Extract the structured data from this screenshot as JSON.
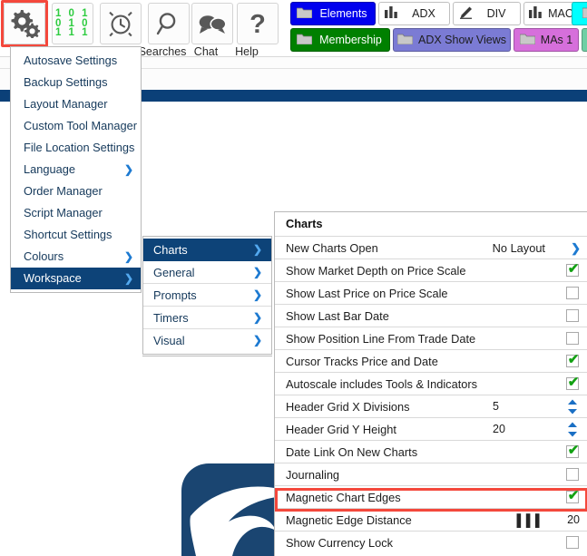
{
  "toolbar": {
    "buttons": [
      {
        "name": "settings",
        "icon": "gears-icon",
        "label": "",
        "highlighted": true
      },
      {
        "name": "binary",
        "icon": "binary-icon",
        "label": "",
        "rows": [
          "1 0 1",
          "0 1 0",
          "1 1 1"
        ]
      },
      {
        "name": "alarm",
        "icon": "alarm-clock-icon",
        "label": ""
      },
      {
        "name": "searches",
        "icon": "magnifier-icon",
        "label": "Searches"
      },
      {
        "name": "chat",
        "icon": "speech-bubbles-icon",
        "label": "Chat"
      },
      {
        "name": "help",
        "icon": "question-mark-icon",
        "label": "Help"
      }
    ],
    "chart_tabs_row1": [
      {
        "label": "Elements",
        "icon": "folder-icon",
        "bg": "#0000ee",
        "fg": "#ffffff"
      },
      {
        "label": "ADX",
        "icon": "bar-chart-icon",
        "bg": "#ffffff",
        "fg": "#1d1d1d"
      },
      {
        "label": "DIV",
        "icon": "pen-icon",
        "bg": "#ffffff",
        "fg": "#1d1d1d"
      },
      {
        "label": "MACDC",
        "icon": "bar-chart-icon",
        "bg": "#ffffff",
        "fg": "#1d1d1d"
      },
      {
        "label": "",
        "icon": "folder-icon",
        "bg": "#00ffff",
        "fg": "#1d1d1d"
      }
    ],
    "chart_tabs_row2": [
      {
        "label": "Membership",
        "icon": "folder-icon",
        "bg": "#008000",
        "fg": "#ffffff"
      },
      {
        "label": "ADX Show Views",
        "icon": "folder-icon",
        "bg": "#7b7bd4",
        "fg": "#1d1d1d"
      },
      {
        "label": "MAs 1",
        "icon": "folder-icon",
        "bg": "#d66fdb",
        "fg": "#1d1d1d"
      },
      {
        "label": "",
        "icon": "folder-icon",
        "bg": "#6fcfa4",
        "fg": "#1d1d1d"
      }
    ]
  },
  "menu": {
    "items": [
      {
        "label": "Autosave Settings",
        "submenu": false,
        "selected": false
      },
      {
        "label": "Backup Settings",
        "submenu": false,
        "selected": false
      },
      {
        "label": "Layout Manager",
        "submenu": false,
        "selected": false
      },
      {
        "label": "Custom Tool Manager",
        "submenu": false,
        "selected": false
      },
      {
        "label": "File Location Settings",
        "submenu": false,
        "selected": false
      },
      {
        "label": "Language",
        "submenu": true,
        "selected": false
      },
      {
        "label": "Order Manager",
        "submenu": false,
        "selected": false
      },
      {
        "label": "Script Manager",
        "submenu": false,
        "selected": false
      },
      {
        "label": "Shortcut Settings",
        "submenu": false,
        "selected": false
      },
      {
        "label": "Colours",
        "submenu": true,
        "selected": false
      },
      {
        "label": "Workspace",
        "submenu": true,
        "selected": true
      }
    ]
  },
  "submenu": {
    "items": [
      {
        "label": "Charts",
        "selected": true
      },
      {
        "label": "General",
        "selected": false
      },
      {
        "label": "Prompts",
        "selected": false
      },
      {
        "label": "Timers",
        "selected": false
      },
      {
        "label": "Visual",
        "selected": false
      }
    ]
  },
  "panel": {
    "title": "Charts",
    "rows": [
      {
        "label": "New Charts Open",
        "control": "dropdown",
        "value": "No Layout",
        "highlighted": false
      },
      {
        "label": "Show Market Depth on Price Scale",
        "control": "checkbox",
        "checked": true,
        "highlighted": false
      },
      {
        "label": "Show Last Price on Price Scale",
        "control": "checkbox",
        "checked": false,
        "highlighted": false
      },
      {
        "label": "Show Last Bar Date",
        "control": "checkbox",
        "checked": false,
        "highlighted": false
      },
      {
        "label": "Show Position Line From Trade Date",
        "control": "checkbox",
        "checked": false,
        "highlighted": false
      },
      {
        "label": "Cursor Tracks Price and Date",
        "control": "checkbox",
        "checked": true,
        "highlighted": false
      },
      {
        "label": "Autoscale includes Tools & Indicators",
        "control": "checkbox",
        "checked": true,
        "highlighted": false
      },
      {
        "label": "Header Grid X Divisions",
        "control": "spinner",
        "value": "5",
        "highlighted": false
      },
      {
        "label": "Header Grid Y Height",
        "control": "spinner",
        "value": "20",
        "highlighted": false
      },
      {
        "label": "Date Link On New Charts",
        "control": "checkbox",
        "checked": true,
        "highlighted": false
      },
      {
        "label": "Journaling",
        "control": "checkbox",
        "checked": false,
        "highlighted": false
      },
      {
        "label": "Magnetic Chart Edges",
        "control": "checkbox",
        "checked": true,
        "highlighted": true
      },
      {
        "label": "Magnetic Edge Distance",
        "control": "slider",
        "value": "20",
        "handle": "▐▐▐",
        "highlighted": false
      },
      {
        "label": "Show Currency Lock",
        "control": "checkbox",
        "checked": false,
        "highlighted": false
      }
    ]
  },
  "colors": {
    "accent_blue": "#0d4378",
    "highlight_red": "#f4483c",
    "check_green": "#12a112",
    "arrow_blue": "#1d7ad1",
    "logo_blue": "#1a4571"
  }
}
